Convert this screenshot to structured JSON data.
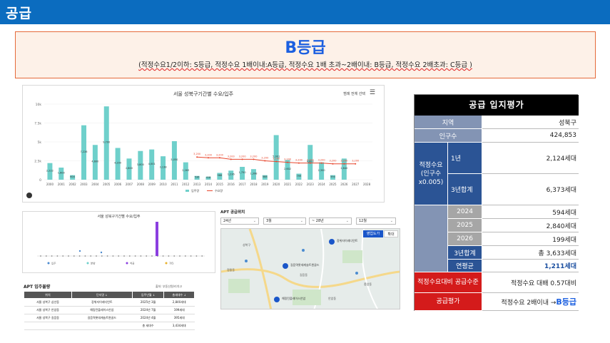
{
  "header": {
    "title": "공급"
  },
  "grade": {
    "title": "B등급",
    "description": "(적정수요1/2이하: S등급, 적정수요 1배이내:A등급, 적정수요 1배 초과~2배이내: B등급, 적정수요 2배초과: C등급 )"
  },
  "bar_chart": {
    "menu_label": "범례 전체 선택",
    "legend": {
      "supply": "입주량",
      "demand": "수요량"
    }
  },
  "chart_data": [
    {
      "type": "bar",
      "title": "서울 성북구기간별 수요/입주",
      "categories": [
        "2000",
        "2001",
        "2002",
        "2003",
        "2004",
        "2005",
        "2006",
        "2007",
        "2008",
        "2009",
        "2010",
        "2011",
        "2012",
        "2013",
        "2014",
        "2015",
        "2016",
        "2017",
        "2018",
        "2019",
        "2020",
        "2021",
        "2022",
        "2023",
        "2024",
        "2025",
        "2026",
        "2027",
        "2028"
      ],
      "series": [
        {
          "name": "입주량",
          "values": [
            2200,
            1600,
            600,
            7200,
            4600,
            9700,
            4200,
            2800,
            3800,
            4000,
            3100,
            5100,
            2300,
            500,
            400,
            900,
            1200,
            1700,
            1400,
            600,
            5900,
            2600,
            800,
            4600,
            2300,
            600,
            2800,
            0,
            0
          ]
        },
        {
          "name": "수요량",
          "values": [
            null,
            null,
            null,
            null,
            null,
            null,
            null,
            null,
            null,
            null,
            null,
            null,
            null,
            null,
            null,
            null,
            null,
            null,
            null,
            null,
            null,
            null,
            null,
            null,
            null,
            null,
            null,
            null,
            null
          ]
        }
      ],
      "demand_line": {
        "years": [
          "2013",
          "2014",
          "2015",
          "2016",
          "2017",
          "2018",
          "2019",
          "2020",
          "2021",
          "2022",
          "2023",
          "2024",
          "2025",
          "2026",
          "2027"
        ],
        "values": [
          3000,
          2900,
          2900,
          2700,
          2700,
          2700,
          2500,
          2400,
          2300,
          2200,
          2200,
          2200,
          2100,
          2100,
          2100
        ]
      },
      "bar_labels": [
        "2,222",
        "1,600",
        "604",
        "7,226",
        "4,600",
        "9,700",
        "4,200",
        "2,800",
        "3,800",
        "4,001",
        "3,138",
        "5,050",
        "2,263",
        "536",
        "418",
        "988",
        "1,236",
        "1,750",
        "1,398",
        "588",
        "5,901",
        "2,602",
        "799",
        "4,600",
        "2,300",
        "594",
        "2,840",
        "",
        ""
      ],
      "line_labels": [
        "3,200",
        "3,200",
        "3,200",
        "3,200",
        "3,200",
        "3,200",
        "3,200",
        "3,200",
        "3,200",
        "3,200",
        "3,200",
        "3,200",
        "3,200",
        "3,200",
        "3,200"
      ],
      "yticks": [
        "0",
        "2.5k",
        "5k",
        "7.5k",
        "10k"
      ],
      "ylim": [
        0,
        10000
      ],
      "grid": true,
      "legend_position": "bottom"
    },
    {
      "type": "scatter",
      "title": "서울 성북구기간별 수요/입주",
      "note": "mini bubble chart"
    }
  ],
  "mini_chart": {
    "title": "서울 성북구기간별 수요/입주",
    "legend": [
      "입주",
      "분양",
      "착공",
      "기타"
    ]
  },
  "apt_table": {
    "title": "APT 입주물량",
    "source": "출처: 부동산원/리치고",
    "headers": [
      "위치",
      "단지명 ↓",
      "입주년월 ↓",
      "총세대수 ↓"
    ],
    "rows": [
      [
        "서울 성북구 삼선동",
        "장위자이레디언트",
        "2025년 3월",
        "2,840세대"
      ],
      [
        "서울 성북구 안암동",
        "해링턴플레이스안암",
        "2024년 7월",
        "199세대"
      ],
      [
        "서울 성북구 길음동",
        "길음역롯데캐슬트윈골드",
        "2024년 4월",
        "395세대"
      ],
      [
        "",
        "",
        "총 세대수",
        "3,434세대"
      ]
    ]
  },
  "map": {
    "title": "APT 공급위치",
    "selects": [
      "24년",
      "3월",
      "28년",
      "12월"
    ],
    "button_a": "영업도가",
    "button_b": "확대",
    "labels": [
      "장위자이레디언트",
      "길음역롯데캐슬트윈골드",
      "해링턴플레이스안암",
      "성북구",
      "정릉동",
      "길음동",
      "안암동",
      "종암동"
    ]
  },
  "evaluation": {
    "title": "공급 입지평가",
    "region_label": "지역",
    "region_value": "성북구",
    "population_label": "인구수",
    "population_value": "424,853",
    "demand_label": "적정수요 (인구수 x0.005)",
    "demand_1y_label": "1년",
    "demand_1y_value": "2,124세대",
    "demand_3y_label": "3년합계",
    "demand_3y_value": "6,373세대",
    "y2024_label": "2024",
    "y2024_value": "594세대",
    "y2025_label": "2025",
    "y2025_value": "2,840세대",
    "y2026_label": "2026",
    "y2026_value": "199세대",
    "sum3_label": "3년합계",
    "sum3_value": "총 3,633세대",
    "avg_label": "연평균",
    "avg_value": "1,211세대",
    "level_label": "적정수요대비 공급수준",
    "level_value": "적정수요 대배 0.57대비",
    "grade_label": "공급평가",
    "grade_prefix": "적정수요 2배이내 →",
    "grade_value": "B등급"
  },
  "colors": {
    "header_blue": "#0b6cbf",
    "bar_teal": "#6fd0cb",
    "line_red": "#e8462d",
    "label_blue": "#2b5495",
    "label_red": "#d41b1b"
  }
}
